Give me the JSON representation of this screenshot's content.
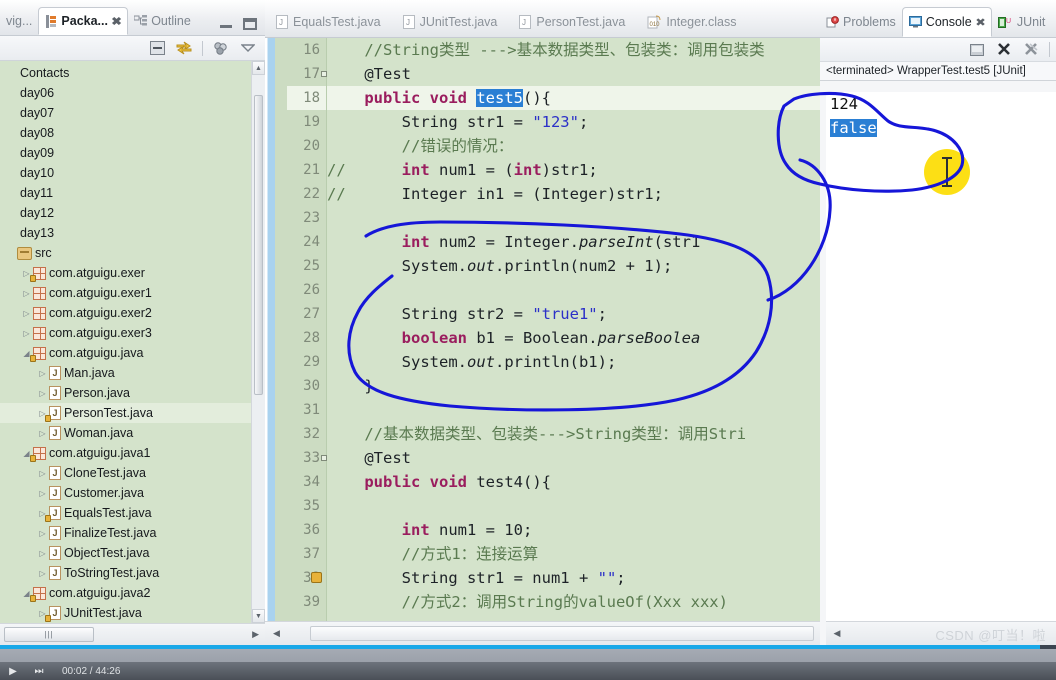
{
  "left_panel": {
    "tabs": [
      {
        "label": "vig...",
        "icon": "navigator-icon",
        "selected": false
      },
      {
        "label": "Packa...",
        "icon": "package-explorer-icon",
        "selected": true,
        "close": "✖"
      },
      {
        "label": "Outline",
        "icon": "outline-icon",
        "selected": false
      }
    ],
    "window_buttons": [
      "minimize",
      "maximize"
    ],
    "toolbar_icons": [
      "collapse-all-icon",
      "link-with-editor-icon",
      "view-menu-icon",
      "view-dropdown-icon"
    ],
    "tree": [
      {
        "label": "Contacts",
        "depth": 0,
        "arrow": "",
        "icon": "none",
        "selected": false
      },
      {
        "label": "day06",
        "depth": 0,
        "arrow": "",
        "icon": "none",
        "selected": false
      },
      {
        "label": "day07",
        "depth": 0,
        "arrow": "",
        "icon": "none",
        "selected": false
      },
      {
        "label": "day08",
        "depth": 0,
        "arrow": "",
        "icon": "none",
        "selected": false
      },
      {
        "label": "day09",
        "depth": 0,
        "arrow": "",
        "icon": "none",
        "selected": false
      },
      {
        "label": "day10",
        "depth": 0,
        "arrow": "",
        "icon": "none",
        "selected": false
      },
      {
        "label": "day11",
        "depth": 0,
        "arrow": "",
        "icon": "none",
        "selected": false
      },
      {
        "label": "day12",
        "depth": 0,
        "arrow": "",
        "icon": "none",
        "selected": false
      },
      {
        "label": "day13",
        "depth": 0,
        "arrow": "",
        "icon": "none",
        "selected": false
      },
      {
        "label": "src",
        "depth": 0,
        "arrow": "",
        "icon": "source-folder",
        "selected": false
      },
      {
        "label": "com.atguigu.exer",
        "depth": 1,
        "arrow": "▷",
        "icon": "package-lock",
        "selected": false
      },
      {
        "label": "com.atguigu.exer1",
        "depth": 1,
        "arrow": "▷",
        "icon": "package",
        "selected": false
      },
      {
        "label": "com.atguigu.exer2",
        "depth": 1,
        "arrow": "▷",
        "icon": "package",
        "selected": false
      },
      {
        "label": "com.atguigu.exer3",
        "depth": 1,
        "arrow": "▷",
        "icon": "package",
        "selected": false
      },
      {
        "label": "com.atguigu.java",
        "depth": 1,
        "arrow": "◢",
        "icon": "package-lock",
        "selected": false
      },
      {
        "label": "Man.java",
        "depth": 2,
        "arrow": "▷",
        "icon": "java-file",
        "selected": false
      },
      {
        "label": "Person.java",
        "depth": 2,
        "arrow": "▷",
        "icon": "java-file",
        "selected": false
      },
      {
        "label": "PersonTest.java",
        "depth": 2,
        "arrow": "▷",
        "icon": "java-file-lock",
        "selected": true
      },
      {
        "label": "Woman.java",
        "depth": 2,
        "arrow": "▷",
        "icon": "java-file",
        "selected": false
      },
      {
        "label": "com.atguigu.java1",
        "depth": 1,
        "arrow": "◢",
        "icon": "package-lock",
        "selected": false
      },
      {
        "label": "CloneTest.java",
        "depth": 2,
        "arrow": "▷",
        "icon": "java-file",
        "selected": false
      },
      {
        "label": "Customer.java",
        "depth": 2,
        "arrow": "▷",
        "icon": "java-file",
        "selected": false
      },
      {
        "label": "EqualsTest.java",
        "depth": 2,
        "arrow": "▷",
        "icon": "java-file-lock",
        "selected": false
      },
      {
        "label": "FinalizeTest.java",
        "depth": 2,
        "arrow": "▷",
        "icon": "java-file",
        "selected": false
      },
      {
        "label": "ObjectTest.java",
        "depth": 2,
        "arrow": "▷",
        "icon": "java-file",
        "selected": false
      },
      {
        "label": "ToStringTest.java",
        "depth": 2,
        "arrow": "▷",
        "icon": "java-file",
        "selected": false
      },
      {
        "label": "com.atguigu.java2",
        "depth": 1,
        "arrow": "◢",
        "icon": "package-lock",
        "selected": false
      },
      {
        "label": "JUnitTest.java",
        "depth": 2,
        "arrow": "▷",
        "icon": "java-file-lock",
        "selected": false
      }
    ]
  },
  "editor": {
    "tabs": [
      {
        "label": "EqualsTest.java",
        "icon": "java-file"
      },
      {
        "label": "JUnitTest.java",
        "icon": "java-file"
      },
      {
        "label": "PersonTest.java",
        "icon": "java-file"
      },
      {
        "label": "Integer.class",
        "icon": "class-file"
      }
    ],
    "first_line_number": 16,
    "highlighted_line": 18,
    "lines": [
      {
        "n": 16,
        "fold": false,
        "warn": false,
        "tokens": [
          {
            "t": "    ",
            "c": "plain"
          },
          {
            "t": "//String类型 --->基本数据类型、包装类：调用包装类",
            "c": "cm"
          }
        ]
      },
      {
        "n": 17,
        "fold": true,
        "warn": false,
        "tokens": [
          {
            "t": "    @Test",
            "c": "plain"
          }
        ]
      },
      {
        "n": 18,
        "fold": false,
        "warn": false,
        "tokens": [
          {
            "t": "    ",
            "c": "plain"
          },
          {
            "t": "public",
            "c": "kw"
          },
          {
            "t": " ",
            "c": "plain"
          },
          {
            "t": "void",
            "c": "kw"
          },
          {
            "t": " ",
            "c": "plain"
          },
          {
            "t": "test5",
            "c": "sel"
          },
          {
            "t": "(){",
            "c": "plain"
          }
        ]
      },
      {
        "n": 19,
        "fold": false,
        "warn": false,
        "tokens": [
          {
            "t": "        String str1 = ",
            "c": "plain"
          },
          {
            "t": "\"123\"",
            "c": "str"
          },
          {
            "t": ";",
            "c": "plain"
          }
        ]
      },
      {
        "n": 20,
        "fold": false,
        "warn": false,
        "tokens": [
          {
            "t": "        //错误的情况：",
            "c": "cm"
          }
        ]
      },
      {
        "n": 21,
        "fold": false,
        "warn": false,
        "tokens": [
          {
            "t": "//",
            "c": "cm"
          },
          {
            "t": "      ",
            "c": "plain"
          },
          {
            "t": "int",
            "c": "kw"
          },
          {
            "t": " num1 = (",
            "c": "plain"
          },
          {
            "t": "int",
            "c": "kw"
          },
          {
            "t": ")str1;",
            "c": "plain"
          }
        ]
      },
      {
        "n": 22,
        "fold": false,
        "warn": false,
        "tokens": [
          {
            "t": "//",
            "c": "cm"
          },
          {
            "t": "      Integer in1 = (Integer)str1;",
            "c": "plain"
          }
        ]
      },
      {
        "n": 23,
        "fold": false,
        "warn": false,
        "tokens": [
          {
            "t": "",
            "c": "plain"
          }
        ]
      },
      {
        "n": 24,
        "fold": false,
        "warn": false,
        "tokens": [
          {
            "t": "        ",
            "c": "plain"
          },
          {
            "t": "int",
            "c": "kw"
          },
          {
            "t": " num2 = Integer.",
            "c": "plain"
          },
          {
            "t": "parseInt",
            "c": "ital"
          },
          {
            "t": "(str1",
            "c": "plain"
          }
        ]
      },
      {
        "n": 25,
        "fold": false,
        "warn": false,
        "tokens": [
          {
            "t": "        System.",
            "c": "plain"
          },
          {
            "t": "out",
            "c": "ital"
          },
          {
            "t": ".println(num2 + 1);",
            "c": "plain"
          }
        ]
      },
      {
        "n": 26,
        "fold": false,
        "warn": false,
        "tokens": [
          {
            "t": "",
            "c": "plain"
          }
        ]
      },
      {
        "n": 27,
        "fold": false,
        "warn": false,
        "tokens": [
          {
            "t": "        String str2 = ",
            "c": "plain"
          },
          {
            "t": "\"true1\"",
            "c": "str"
          },
          {
            "t": ";",
            "c": "plain"
          }
        ]
      },
      {
        "n": 28,
        "fold": false,
        "warn": false,
        "tokens": [
          {
            "t": "        ",
            "c": "plain"
          },
          {
            "t": "boolean",
            "c": "kw"
          },
          {
            "t": " b1 = Boolean.",
            "c": "plain"
          },
          {
            "t": "parseBoolea",
            "c": "ital"
          }
        ]
      },
      {
        "n": 29,
        "fold": false,
        "warn": false,
        "tokens": [
          {
            "t": "        System.",
            "c": "plain"
          },
          {
            "t": "out",
            "c": "ital"
          },
          {
            "t": ".println(b1);",
            "c": "plain"
          }
        ]
      },
      {
        "n": 30,
        "fold": false,
        "warn": false,
        "tokens": [
          {
            "t": "    }",
            "c": "plain"
          }
        ]
      },
      {
        "n": 31,
        "fold": false,
        "warn": false,
        "tokens": [
          {
            "t": "",
            "c": "plain"
          }
        ]
      },
      {
        "n": 32,
        "fold": false,
        "warn": false,
        "tokens": [
          {
            "t": "    ",
            "c": "plain"
          },
          {
            "t": "//基本数据类型、包装类--->String类型：调用Stri",
            "c": "cm"
          }
        ]
      },
      {
        "n": 33,
        "fold": true,
        "warn": false,
        "tokens": [
          {
            "t": "    @Test",
            "c": "plain"
          }
        ]
      },
      {
        "n": 34,
        "fold": false,
        "warn": false,
        "tokens": [
          {
            "t": "    ",
            "c": "plain"
          },
          {
            "t": "public",
            "c": "kw"
          },
          {
            "t": " ",
            "c": "plain"
          },
          {
            "t": "void",
            "c": "kw"
          },
          {
            "t": " test4(){",
            "c": "plain"
          }
        ]
      },
      {
        "n": 35,
        "fold": false,
        "warn": false,
        "tokens": [
          {
            "t": "",
            "c": "plain"
          }
        ]
      },
      {
        "n": 36,
        "fold": false,
        "warn": false,
        "tokens": [
          {
            "t": "        ",
            "c": "plain"
          },
          {
            "t": "int",
            "c": "kw"
          },
          {
            "t": " num1 = 10;",
            "c": "plain"
          }
        ]
      },
      {
        "n": 37,
        "fold": false,
        "warn": false,
        "tokens": [
          {
            "t": "        //方式1：连接运算",
            "c": "cm"
          }
        ]
      },
      {
        "n": 38,
        "fold": false,
        "warn": true,
        "tokens": [
          {
            "t": "        String str1 = num1 + ",
            "c": "plain"
          },
          {
            "t": "\"\"",
            "c": "str"
          },
          {
            "t": ";",
            "c": "plain"
          }
        ]
      },
      {
        "n": 39,
        "fold": false,
        "warn": false,
        "tokens": [
          {
            "t": "        //方式2：调用String的valueOf(Xxx xxx)",
            "c": "cm"
          }
        ]
      }
    ]
  },
  "console": {
    "tabs": [
      {
        "label": "Problems",
        "icon": "problems-icon",
        "selected": false
      },
      {
        "label": "Console",
        "icon": "console-icon",
        "selected": true,
        "close": "✖"
      },
      {
        "label": "JUnit",
        "icon": "junit-icon",
        "selected": false
      }
    ],
    "toolbar_icons": [
      "clear-console-icon",
      "terminate-icon",
      "remove-all-terminated-icon"
    ],
    "terminated_label": "<terminated> WrapperTest.test5 [JUnit]",
    "output": [
      {
        "text": "124",
        "selected": false
      },
      {
        "text": "false",
        "selected": true
      }
    ]
  },
  "annotations": {
    "ink_color": "#1616d8",
    "highlight_color": "#fcdf15",
    "shapes": [
      "oval-around-code-block-lines-24-30",
      "oval-around-console-output",
      "highlight-dot-cursor"
    ]
  },
  "player": {
    "current_time": "00:02",
    "total_time": "44:26",
    "time_display": "00:02 / 44:26",
    "play_icon": "▶",
    "next_icon": "⏭",
    "progress_percent": 98
  },
  "watermark": "CSDN @叮当！啦"
}
